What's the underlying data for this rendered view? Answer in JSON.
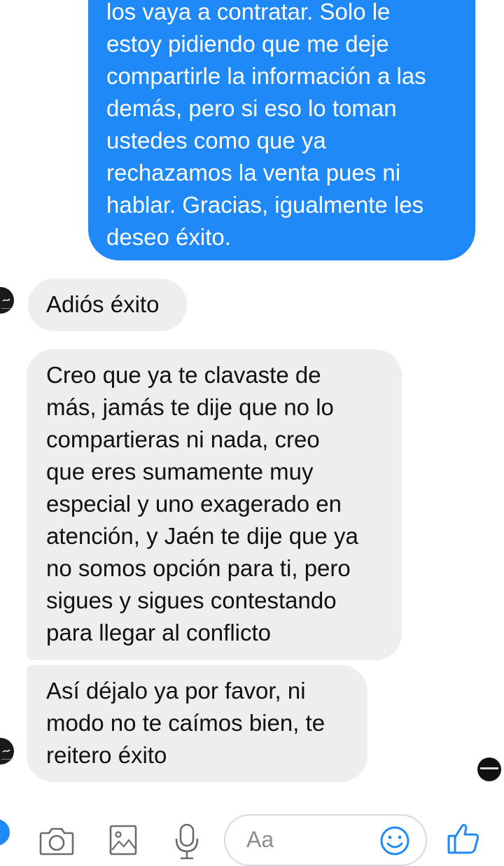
{
  "messages": [
    {
      "sender": "me",
      "text": "los vaya a contratar. Solo le\nestoy pidiendo que me deje\ncompartirle la información a las\ndemás, pero si eso lo toman\nustedes como que ya\nrechazamos la venta pues ni\nhablar. Gracias, igualmente les\ndeseo éxito."
    },
    {
      "sender": "them",
      "text": "Adiós éxito"
    },
    {
      "sender": "them",
      "text": "Creo que ya te clavaste de\nmás, jamás te dije que no lo\ncompartieras ni nada, creo\nque eres sumamente muy\nespecial y uno exagerado en\natención, y Jaén te dije que ya\nno somos opción para ti, pero\nsigues y sigues contestando\npara llegar al conflicto"
    },
    {
      "sender": "them",
      "text": "Así déjalo ya por favor, ni\nmodo no te caímos bien, te\nreitero éxito"
    }
  ],
  "composer": {
    "placeholder": "Aa",
    "icons": [
      "camera-icon",
      "gallery-icon",
      "microphone-icon",
      "emoji-icon",
      "thumbs-up-icon"
    ]
  },
  "colors": {
    "outgoing_bubble": "#1f89f7",
    "incoming_bubble": "#eeeeef",
    "accent": "#1f89f7"
  }
}
